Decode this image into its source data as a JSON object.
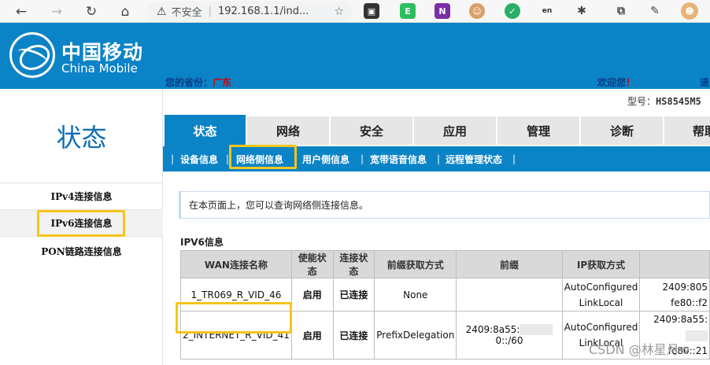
{
  "browser": {
    "back_icon": "←",
    "forward_icon": "→",
    "reload_icon": "↻",
    "home_icon": "⌂",
    "security_icon": "⚠",
    "insecure_label": "不安全",
    "url": "192.168.1.1/ind...",
    "extensions": [
      "tab-ext",
      "evernote",
      "onenote",
      "ext-face",
      "wechat-ext",
      "translate-ext",
      "puzzle",
      "collections",
      "edit",
      "profile"
    ]
  },
  "header": {
    "logo_cn": "中国移动",
    "logo_en": "China Mobile",
    "province_label": "您的省份：",
    "province_value": "广东",
    "welcome": "欢迎您",
    "welcome_mark": "！",
    "logout_partial": "退"
  },
  "sidebar": {
    "title": "状态",
    "items": [
      {
        "label": "IPv4连接信息"
      },
      {
        "label": "IPv6连接信息"
      },
      {
        "label": "PON链路连接信息"
      }
    ]
  },
  "model": {
    "label": "型号：",
    "value": "HS8545M5"
  },
  "tabs": [
    {
      "label": "状态"
    },
    {
      "label": "网络"
    },
    {
      "label": "安全"
    },
    {
      "label": "应用"
    },
    {
      "label": "管理"
    },
    {
      "label": "诊断"
    },
    {
      "label": "帮助"
    }
  ],
  "subnav": [
    {
      "label": "设备信息"
    },
    {
      "label": "网络侧信息"
    },
    {
      "label": "用户侧信息"
    },
    {
      "label": "宽带语音信息"
    },
    {
      "label": "远程管理状态"
    }
  ],
  "info_text": "在本页面上，您可以查询网络侧连接信息。",
  "section_title": "IPV6信息",
  "table": {
    "headers": [
      "WAN连接名称",
      "使能状态",
      "连接状态",
      "前缀获取方式",
      "前缀",
      "IP获取方式",
      ""
    ],
    "rows": [
      {
        "name": "1_TR069_R_VID_46",
        "enable": "启用",
        "status": "已连接",
        "prefix_mode": "None",
        "prefix": "",
        "ip_mode_1": "AutoConfigured",
        "ip_mode_2": "LinkLocal",
        "ip_1": "2409:805",
        "ip_2": "fe80::f2"
      },
      {
        "name": "2_INTERNET_R_VID_41",
        "enable": "启用",
        "status": "已连接",
        "prefix_mode": "PrefixDelegation",
        "prefix_a": "2409:8a55:",
        "prefix_b": "0::/60",
        "ip_mode_1": "AutoConfigured",
        "ip_mode_2": "LinkLocal",
        "ip_1": "2409:8a55:",
        "ip_2": "fe80::21"
      }
    ]
  },
  "watermark": "CSDN @林星月w",
  "colors": {
    "brand_blue": "#0b83c7",
    "highlight": "#f5c518",
    "red": "#d40000"
  }
}
